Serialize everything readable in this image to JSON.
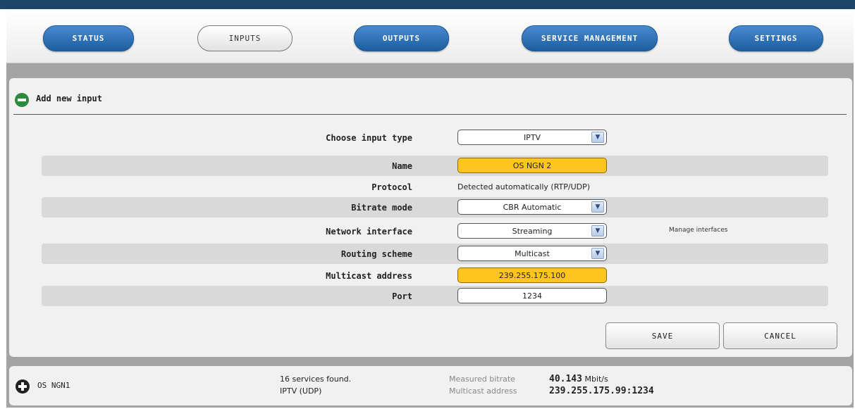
{
  "nav": {
    "status": "STATUS",
    "inputs": "INPUTS",
    "outputs": "OUTPUTS",
    "service_management": "SERVICE MANAGEMENT",
    "settings": "SETTINGS",
    "active": "INPUTS"
  },
  "form": {
    "title": "Add new input",
    "choose_input_type": {
      "label": "Choose input type",
      "value": "IPTV"
    },
    "name": {
      "label": "Name",
      "value": "OS NGN 2"
    },
    "protocol": {
      "label": "Protocol",
      "value": "Detected automatically (RTP/UDP)"
    },
    "bitrate_mode": {
      "label": "Bitrate mode",
      "value": "CBR Automatic"
    },
    "network_interface": {
      "label": "Network interface",
      "value": "Streaming",
      "link": "Manage interfaces"
    },
    "routing_scheme": {
      "label": "Routing scheme",
      "value": "Multicast"
    },
    "multicast_address": {
      "label": "Multicast address",
      "value": "239.255.175.100"
    },
    "port": {
      "label": "Port",
      "value": "1234"
    },
    "save": "SAVE",
    "cancel": "CANCEL"
  },
  "existing_input": {
    "name": "OS NGN1",
    "services_found": "16 services found.",
    "type": "IPTV (UDP)",
    "measured_bitrate_label": "Measured bitrate",
    "measured_bitrate_value": "40.143",
    "measured_bitrate_unit": "Mbit/s",
    "multicast_address_label": "Multicast address",
    "multicast_address_value": "239.255.175.99:1234"
  },
  "icons": {
    "collapse": "minus-circle-icon",
    "expand": "plus-circle-icon",
    "dropdown": "chevron-down-icon"
  },
  "colors": {
    "nav_blue": "#1c5e9f",
    "highlight_yellow": "#ffc51f",
    "top_bar": "#1b4668"
  }
}
